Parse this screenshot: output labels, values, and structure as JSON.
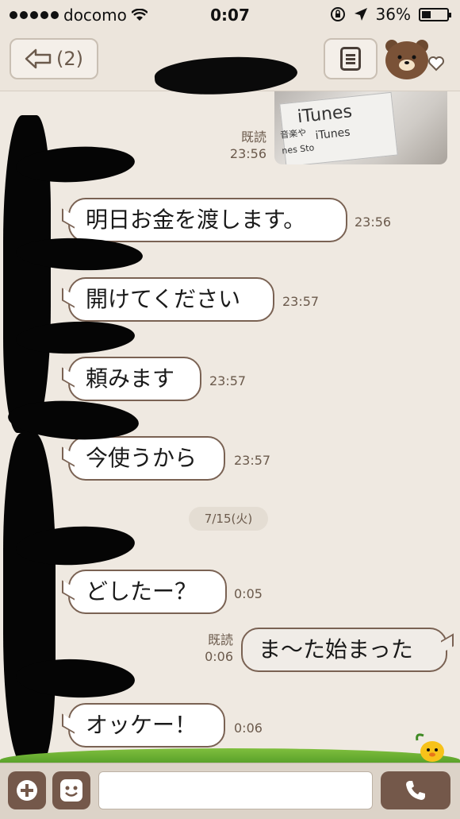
{
  "status": {
    "carrier": "docomo",
    "time": "0:07",
    "battery": "36%",
    "battery_fraction": 0.36
  },
  "header": {
    "back_count": "(2)"
  },
  "sent_image": {
    "text_1": "iTunes",
    "text_2": "iTunes",
    "text_3": "音楽や",
    "text_4": "nes Sto"
  },
  "messages": [
    {
      "meta_read": "既読",
      "time": "23:56"
    },
    {
      "text": "明日お金を渡します。",
      "time": "23:56"
    },
    {
      "text": "開けてください",
      "time": "23:57"
    },
    {
      "text": "頼みます",
      "time": "23:57"
    },
    {
      "text": "今使うから",
      "time": "23:57"
    },
    {
      "date": "7/15(火)"
    },
    {
      "text": "どしたー？",
      "time": "0:05"
    },
    {
      "text": "ま〜た始まった",
      "read": "既読",
      "time": "0:06"
    },
    {
      "text": "オッケー！",
      "time": "0:06"
    }
  ],
  "colors": {
    "bubble_border": "#7a6253",
    "background": "#efe9e1",
    "button": "#74584a"
  },
  "icons": [
    "wifi-icon",
    "lock-rotation-icon",
    "location-arrow-icon",
    "battery-icon",
    "back-arrow-icon",
    "menu-icon",
    "bear-avatar-icon",
    "heart-icon",
    "plus-icon",
    "emoji-icon",
    "phone-icon",
    "chick-mascot-icon"
  ]
}
